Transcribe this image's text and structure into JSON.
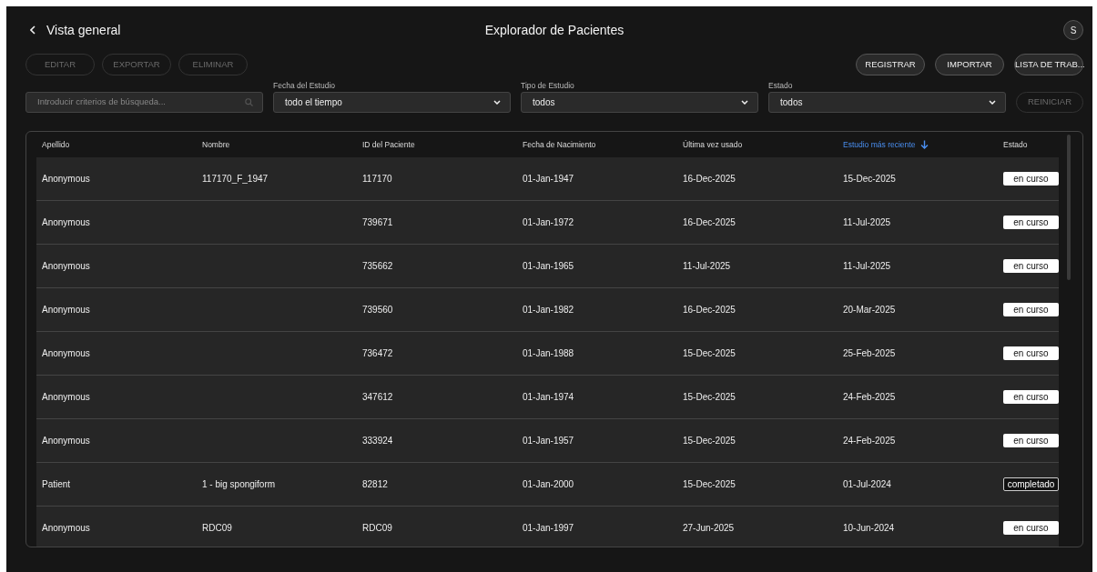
{
  "header": {
    "back_label": "Vista general",
    "title": "Explorador de Pacientes",
    "avatar": "S"
  },
  "actions_left": [
    {
      "label": "EDITAR",
      "disabled": true
    },
    {
      "label": "EXPORTAR",
      "disabled": true
    },
    {
      "label": "ELIMINAR",
      "disabled": true
    }
  ],
  "actions_right": [
    {
      "label": "REGISTRAR",
      "disabled": false
    },
    {
      "label": "IMPORTAR",
      "disabled": false
    },
    {
      "label": "LISTA DE TRAB...",
      "disabled": false
    }
  ],
  "filters": {
    "search": {
      "placeholder": "Introducir criterios de búsqueda..."
    },
    "selects": [
      {
        "label": "Fecha del Estudio",
        "value": "todo el tiempo"
      },
      {
        "label": "Tipo de Estudio",
        "value": "todos"
      },
      {
        "label": "Estado",
        "value": "todos"
      }
    ],
    "reset": {
      "label": "REINICIAR",
      "disabled": true
    }
  },
  "table": {
    "columns": [
      {
        "label": "Apellido",
        "sorted": false
      },
      {
        "label": "Nombre",
        "sorted": false
      },
      {
        "label": "ID del Paciente",
        "sorted": false
      },
      {
        "label": "Fecha de Nacimiento",
        "sorted": false
      },
      {
        "label": "Última vez usado",
        "sorted": false
      },
      {
        "label": "Estudio más reciente",
        "sorted": true
      },
      {
        "label": "Estado",
        "sorted": false
      }
    ],
    "rows": [
      {
        "cells": [
          "Anonymous",
          "117170_F_1947",
          "117170",
          "01-Jan-1947",
          "16-Dec-2025",
          "15-Dec-2025"
        ],
        "status": {
          "text": "en curso",
          "kind": "filled"
        }
      },
      {
        "cells": [
          "Anonymous",
          "",
          "739671",
          "01-Jan-1972",
          "16-Dec-2025",
          "11-Jul-2025"
        ],
        "status": {
          "text": "en curso",
          "kind": "filled"
        }
      },
      {
        "cells": [
          "Anonymous",
          "",
          "735662",
          "01-Jan-1965",
          "11-Jul-2025",
          "11-Jul-2025"
        ],
        "status": {
          "text": "en curso",
          "kind": "filled"
        }
      },
      {
        "cells": [
          "Anonymous",
          "",
          "739560",
          "01-Jan-1982",
          "16-Dec-2025",
          "20-Mar-2025"
        ],
        "status": {
          "text": "en curso",
          "kind": "filled"
        }
      },
      {
        "cells": [
          "Anonymous",
          "",
          "736472",
          "01-Jan-1988",
          "15-Dec-2025",
          "25-Feb-2025"
        ],
        "status": {
          "text": "en curso",
          "kind": "filled"
        }
      },
      {
        "cells": [
          "Anonymous",
          "",
          "347612",
          "01-Jan-1974",
          "15-Dec-2025",
          "24-Feb-2025"
        ],
        "status": {
          "text": "en curso",
          "kind": "filled"
        }
      },
      {
        "cells": [
          "Anonymous",
          "",
          "333924",
          "01-Jan-1957",
          "15-Dec-2025",
          "24-Feb-2025"
        ],
        "status": {
          "text": "en curso",
          "kind": "filled"
        }
      },
      {
        "cells": [
          "Patient",
          "1 - big spongiform",
          "82812",
          "01-Jan-2000",
          "15-Dec-2025",
          "01-Jul-2024"
        ],
        "status": {
          "text": "completado",
          "kind": "outlined"
        }
      },
      {
        "cells": [
          "Anonymous",
          "RDC09",
          "RDC09",
          "01-Jan-1997",
          "27-Jun-2025",
          "10-Jun-2024"
        ],
        "status": {
          "text": "en curso",
          "kind": "filled"
        }
      }
    ]
  }
}
